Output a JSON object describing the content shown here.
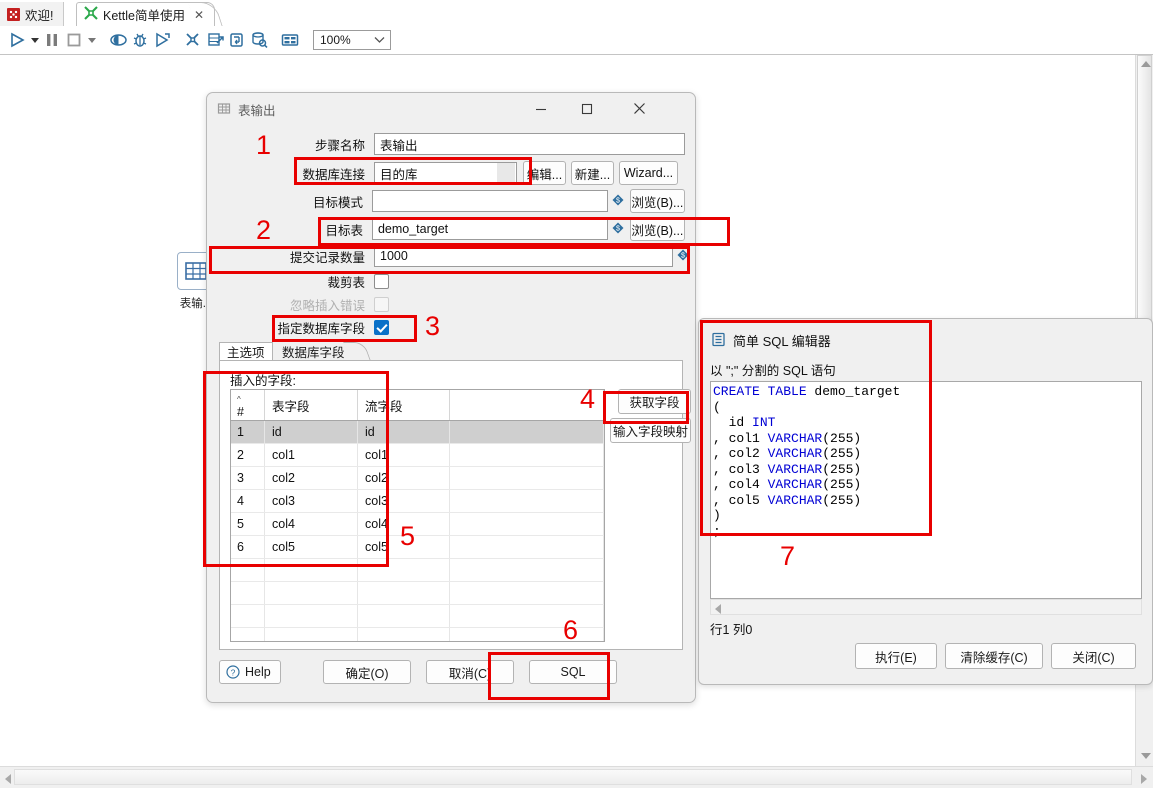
{
  "tabs": {
    "welcome": {
      "label": "欢迎!",
      "icon": "welcome-icon"
    },
    "active": {
      "label": "Kettle简单使用",
      "icon": "kettle-icon",
      "close": "✕"
    }
  },
  "toolbar": {
    "zoom_value": "100%",
    "icons": [
      "run-icon",
      "run-dropdown-caret",
      "pause-icon",
      "stop-icon",
      "stop-dropdown-caret",
      "preview-icon",
      "debug-icon",
      "replay-icon",
      "transformation-icon",
      "metrics-icon",
      "logging-icon",
      "db-explore-icon",
      "grid-icon"
    ]
  },
  "canvas": {
    "step_node_label": "表输..."
  },
  "dialog": {
    "title": "表输出",
    "window_buttons": {
      "minimize": "—",
      "maximize": "☐",
      "close": "✕"
    },
    "fields": {
      "step_name": {
        "label": "步骤名称",
        "value": "表输出"
      },
      "db_connection": {
        "label": "数据库连接",
        "value": "目的库"
      },
      "target_schema": {
        "label": "目标模式",
        "value": ""
      },
      "target_table": {
        "label": "目标表",
        "value": "demo_target"
      },
      "commit_size": {
        "label": "提交记录数量",
        "value": "1000"
      }
    },
    "buttons": {
      "edit": "编辑...",
      "new": "新建...",
      "wizard": "Wizard...",
      "browse_schema": "浏览(B)...",
      "browse_table": "浏览(B)..."
    },
    "checkboxes": {
      "truncate_table": {
        "label": "裁剪表",
        "checked": false,
        "enabled": true
      },
      "ignore_insert_errors": {
        "label": "忽略插入错误",
        "checked": false,
        "enabled": false
      },
      "specify_db_fields": {
        "label": "指定数据库字段",
        "checked": true,
        "enabled": true
      }
    },
    "inner_tabs": [
      {
        "label": "主选项",
        "selected": true
      },
      {
        "label": "数据库字段",
        "selected": false
      }
    ],
    "insert_fields_label": "插入的字段:",
    "grid": {
      "headers": [
        "#",
        "表字段",
        "流字段"
      ],
      "rows": [
        {
          "n": "1",
          "table_field": "id",
          "stream_field": "id",
          "selected": true
        },
        {
          "n": "2",
          "table_field": "col1",
          "stream_field": "col1",
          "selected": false
        },
        {
          "n": "3",
          "table_field": "col2",
          "stream_field": "col2",
          "selected": false
        },
        {
          "n": "4",
          "table_field": "col3",
          "stream_field": "col3",
          "selected": false
        },
        {
          "n": "5",
          "table_field": "col4",
          "stream_field": "col4",
          "selected": false
        },
        {
          "n": "6",
          "table_field": "col5",
          "stream_field": "col5",
          "selected": false
        }
      ]
    },
    "side_buttons": {
      "get_fields": "获取字段",
      "input_field_mapping": "输入字段映射"
    },
    "footer": {
      "help": "Help",
      "ok": "确定(O)",
      "cancel": "取消(C)",
      "sql": "SQL"
    }
  },
  "sql_editor": {
    "title": "简单 SQL 编辑器",
    "subtitle": "以 \";\" 分割的 SQL 语句",
    "statement_lines": [
      {
        "kw": "CREATE TABLE",
        "rest": " demo_target"
      },
      {
        "kw": "",
        "rest": "("
      },
      {
        "kw": "",
        "rest": "  id ",
        "kw2": "INT"
      },
      {
        "kw": "",
        "rest": ", col1 ",
        "kw2": "VARCHAR",
        "tail": "(255)"
      },
      {
        "kw": "",
        "rest": ", col2 ",
        "kw2": "VARCHAR",
        "tail": "(255)"
      },
      {
        "kw": "",
        "rest": ", col3 ",
        "kw2": "VARCHAR",
        "tail": "(255)"
      },
      {
        "kw": "",
        "rest": ", col4 ",
        "kw2": "VARCHAR",
        "tail": "(255)"
      },
      {
        "kw": "",
        "rest": ", col5 ",
        "kw2": "VARCHAR",
        "tail": "(255)"
      },
      {
        "kw": "",
        "rest": ")"
      },
      {
        "kw": "",
        "rest": ";"
      }
    ],
    "position": "行1 列0",
    "buttons": {
      "execute": "执行(E)",
      "clear_cache": "清除缓存(C)",
      "close": "关闭(C)"
    }
  },
  "annotations": {
    "color": "#e80000",
    "numbers": [
      "1",
      "2",
      "3",
      "4",
      "5",
      "6",
      "7"
    ]
  }
}
